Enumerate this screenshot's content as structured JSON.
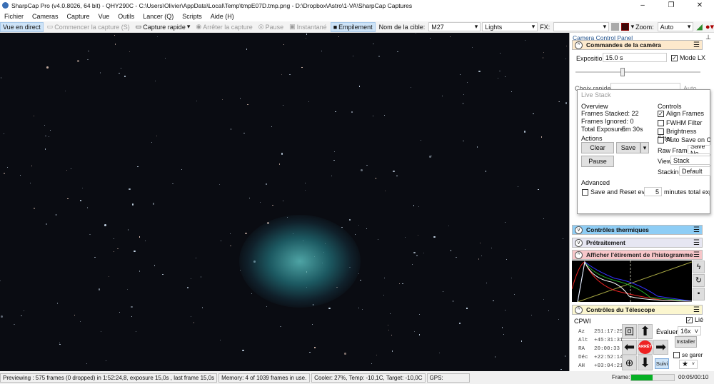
{
  "title": "SharpCap Pro (v4.0.8026, 64 bit) - QHY290C - C:\\Users\\Olivier\\AppData\\Local\\Temp\\tmpE07D.tmp.png - D:\\Dropbox\\Astro\\1-VA\\SharpCap Captures",
  "menu": [
    "Fichier",
    "Cameras",
    "Capture",
    "Vue",
    "Outils",
    "Lancer (Q)",
    "Scripts",
    "Aide (H)"
  ],
  "toolbar": {
    "live": "Vue en direct",
    "start": "Commencer la capture (S)",
    "quick": "Capture rapide",
    "stop": "Arrêter la capture",
    "pause": "Pause",
    "snapshot": "Instantané",
    "stack": "Empilement",
    "target_label": "Nom de la cible:",
    "target": "M27",
    "frame_type": "Lights",
    "fx_label": "FX:",
    "fx": "",
    "zoom_label": "Zoom:",
    "zoom": "Auto"
  },
  "panel": {
    "title": "Camera Control Panel",
    "camera": {
      "header": "Commandes de la caméra",
      "exposure_label": "Exposition",
      "exposure": "15.0 s",
      "mode_lx": "Mode LX",
      "mode_lx_checked": true,
      "quick_label": "Choix rapides",
      "auto": "Auto"
    },
    "sections": [
      "Contrôles thermiques",
      "Prétraitement",
      "Afficher l'étirement de l'histogramme"
    ],
    "section_colors": [
      "#8ecdf5",
      "#e6e6f2",
      "#f7c6c9"
    ],
    "telescope": {
      "header": "Contrôles du Télescope",
      "mount": "CPWI",
      "linked": "Lié",
      "linked_checked": true,
      "rate_label": "Évaluer:",
      "rate": "16x",
      "install": "Installer",
      "park": "se garer",
      "stop": "ARRÊTE",
      "track": "Suivi",
      "coords": [
        {
          "k": "Az",
          "v": "251:17:29"
        },
        {
          "k": "Alt",
          "v": "+45:31:31"
        },
        {
          "k": "RA",
          "v": "20:00:33"
        },
        {
          "k": "Déc",
          "v": "+22:52:14"
        },
        {
          "k": "AH",
          "v": "+03:04:21"
        }
      ]
    },
    "frame_label": "Frame:",
    "frame_progress": 0.5,
    "frame_time": "00:05/00:10"
  },
  "livestack": {
    "title": "Live Stack",
    "overview": "Overview",
    "stacked": "Frames Stacked: 22",
    "ignored": "Frames Ignored: 0",
    "exposure_label": "Total Exposure:",
    "exposure": "5m 30s",
    "actions": "Actions",
    "clear": "Clear",
    "save": "Save",
    "pause": "Pause",
    "controls": "Controls",
    "align": "Align Frames",
    "align_checked": true,
    "fwhm": "FWHM Filter",
    "brightness": "Brightness Filter",
    "autosave": "Auto Save on Clear",
    "raw_label": "Raw Frames",
    "raw": "Save No",
    "view_label": "View",
    "view": "Stack",
    "stacking_label": "Stacking",
    "stacking": "Default",
    "advanced": "Advanced",
    "save_reset": "Save and Reset every",
    "minutes": "5",
    "minutes_suffix": "minutes total exposure"
  },
  "status": {
    "preview": "Previewing : 575 frames (0 dropped) in 1:52:24,8, exposure 15,0s , last frame 15,0s",
    "memory": "Memory: 4 of 1039 frames in use.",
    "cooler": "Cooler: 27%, Temp: -10,1C, Target: -10,0C",
    "gps": "GPS:"
  }
}
